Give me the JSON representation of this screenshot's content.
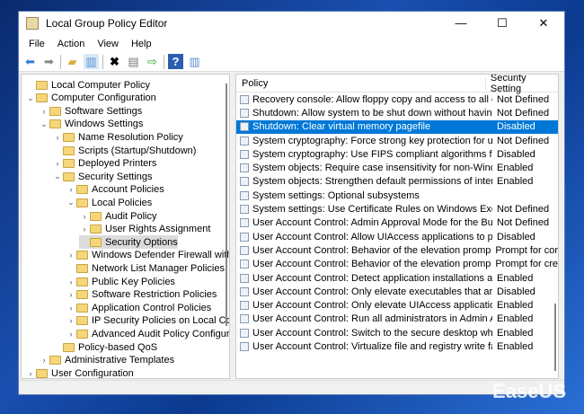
{
  "window": {
    "title": "Local Group Policy Editor",
    "min": "—",
    "max": "☐",
    "close": "✕"
  },
  "menu": [
    "File",
    "Action",
    "View",
    "Help"
  ],
  "toolbar": [
    "back-icon",
    "forward-icon",
    "up-folder-icon",
    "show-hide-tree-icon",
    "delete-icon",
    "properties-icon",
    "export-list-icon",
    "help-icon",
    "show-hide-action-pane-icon"
  ],
  "tree": [
    {
      "label": "Local Computer Policy",
      "level": 0,
      "chev": ""
    },
    {
      "label": "Computer Configuration",
      "level": 0,
      "chev": "v"
    },
    {
      "label": "Software Settings",
      "level": 1,
      "chev": ">"
    },
    {
      "label": "Windows Settings",
      "level": 1,
      "chev": "v"
    },
    {
      "label": "Name Resolution Policy",
      "level": 2,
      "chev": ">"
    },
    {
      "label": "Scripts (Startup/Shutdown)",
      "level": 2,
      "chev": ""
    },
    {
      "label": "Deployed Printers",
      "level": 2,
      "chev": ">"
    },
    {
      "label": "Security Settings",
      "level": 2,
      "chev": "v"
    },
    {
      "label": "Account Policies",
      "level": 3,
      "chev": ">"
    },
    {
      "label": "Local Policies",
      "level": 3,
      "chev": "v"
    },
    {
      "label": "Audit Policy",
      "level": 4,
      "chev": ">"
    },
    {
      "label": "User Rights Assignment",
      "level": 4,
      "chev": ">"
    },
    {
      "label": "Security Options",
      "level": 4,
      "chev": "",
      "selected": true
    },
    {
      "label": "Windows Defender Firewall with A",
      "level": 3,
      "chev": ">"
    },
    {
      "label": "Network List Manager Policies",
      "level": 3,
      "chev": ""
    },
    {
      "label": "Public Key Policies",
      "level": 3,
      "chev": ">"
    },
    {
      "label": "Software Restriction Policies",
      "level": 3,
      "chev": ">"
    },
    {
      "label": "Application Control Policies",
      "level": 3,
      "chev": ">"
    },
    {
      "label": "IP Security Policies on Local Com",
      "level": 3,
      "chev": ">"
    },
    {
      "label": "Advanced Audit Policy Configura",
      "level": 3,
      "chev": ">"
    },
    {
      "label": "Policy-based QoS",
      "level": 2,
      "chev": ""
    },
    {
      "label": "Administrative Templates",
      "level": 1,
      "chev": ">"
    },
    {
      "label": "User Configuration",
      "level": 0,
      "chev": ">"
    }
  ],
  "list": {
    "headers": [
      "Policy",
      "Security Setting"
    ],
    "rows": [
      [
        "Recovery console: Allow floppy copy and access to all drives...",
        "Not Defined"
      ],
      [
        "Shutdown: Allow system to be shut down without having to...",
        "Not Defined"
      ],
      [
        "Shutdown: Clear virtual memory pagefile",
        "Disabled"
      ],
      [
        "System cryptography: Force strong key protection for user k...",
        "Not Defined"
      ],
      [
        "System cryptography: Use FIPS compliant algorithms for en...",
        "Disabled"
      ],
      [
        "System objects: Require case insensitivity for non-Windows ...",
        "Enabled"
      ],
      [
        "System objects: Strengthen default permissions of internal s...",
        "Enabled"
      ],
      [
        "System settings: Optional subsystems",
        ""
      ],
      [
        "System settings: Use Certificate Rules on Windows Executab...",
        "Not Defined"
      ],
      [
        "User Account Control: Admin Approval Mode for the Built-i...",
        "Not Defined"
      ],
      [
        "User Account Control: Allow UIAccess applications to prom...",
        "Disabled"
      ],
      [
        "User Account Control: Behavior of the elevation prompt for ...",
        "Prompt for cor"
      ],
      [
        "User Account Control: Behavior of the elevation prompt for ...",
        "Prompt for cre"
      ],
      [
        "User Account Control: Detect application installations and p...",
        "Enabled"
      ],
      [
        "User Account Control: Only elevate executables that are sig...",
        "Disabled"
      ],
      [
        "User Account Control: Only elevate UIAccess applications th...",
        "Enabled"
      ],
      [
        "User Account Control: Run all administrators in Admin Appr...",
        "Enabled"
      ],
      [
        "User Account Control: Switch to the secure desktop when pr...",
        "Enabled"
      ],
      [
        "User Account Control: Virtualize file and registry write failure...",
        "Enabled"
      ]
    ],
    "selected": 2
  },
  "watermark": "EaseUS"
}
